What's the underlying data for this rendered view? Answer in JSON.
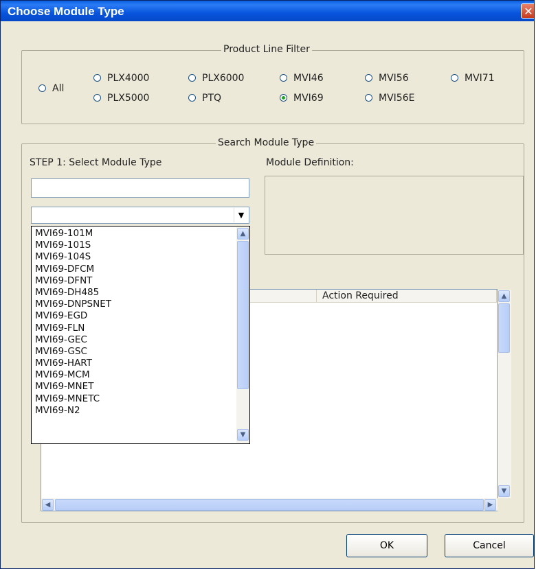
{
  "window": {
    "title": "Choose Module Type",
    "close_glyph": "✕"
  },
  "product_line_filter": {
    "legend": "Product Line Filter",
    "options": [
      {
        "label": "All",
        "checked": false
      },
      {
        "label": "PLX4000",
        "checked": false
      },
      {
        "label": "PLX5000",
        "checked": false
      },
      {
        "label": "PLX6000",
        "checked": false
      },
      {
        "label": "PTQ",
        "checked": false
      },
      {
        "label": "MVI46",
        "checked": false
      },
      {
        "label": "MVI69",
        "checked": true
      },
      {
        "label": "MVI56",
        "checked": false
      },
      {
        "label": "MVI56E",
        "checked": false
      },
      {
        "label": "MVI71",
        "checked": false
      }
    ]
  },
  "search": {
    "legend": "Search Module Type",
    "step1_label": "STEP 1: Select Module Type",
    "module_definition_label": "Module Definition:",
    "search_value": "",
    "combo_value": "",
    "dropdown_items": [
      "MVI69-101M",
      "MVI69-101S",
      "MVI69-104S",
      "MVI69-DFCM",
      "MVI69-DFNT",
      "MVI69-DH485",
      "MVI69-DNPSNET",
      "MVI69-EGD",
      "MVI69-FLN",
      "MVI69-GEC",
      "MVI69-GSC",
      "MVI69-HART",
      "MVI69-MCM",
      "MVI69-MNET",
      "MVI69-MNETC",
      "MVI69-N2"
    ],
    "table": {
      "columns": [
        "",
        "Action Required"
      ],
      "rows": []
    }
  },
  "buttons": {
    "ok": "OK",
    "cancel": "Cancel"
  },
  "colors": {
    "titlebar": "#0A5FE0",
    "dialog_bg": "#ECE9D8",
    "radio_checked": "#21A121"
  },
  "icons": {
    "scroll_up": "▲",
    "scroll_down": "▼",
    "scroll_left": "◀",
    "scroll_right": "▶",
    "combo_arrow": "▼"
  }
}
